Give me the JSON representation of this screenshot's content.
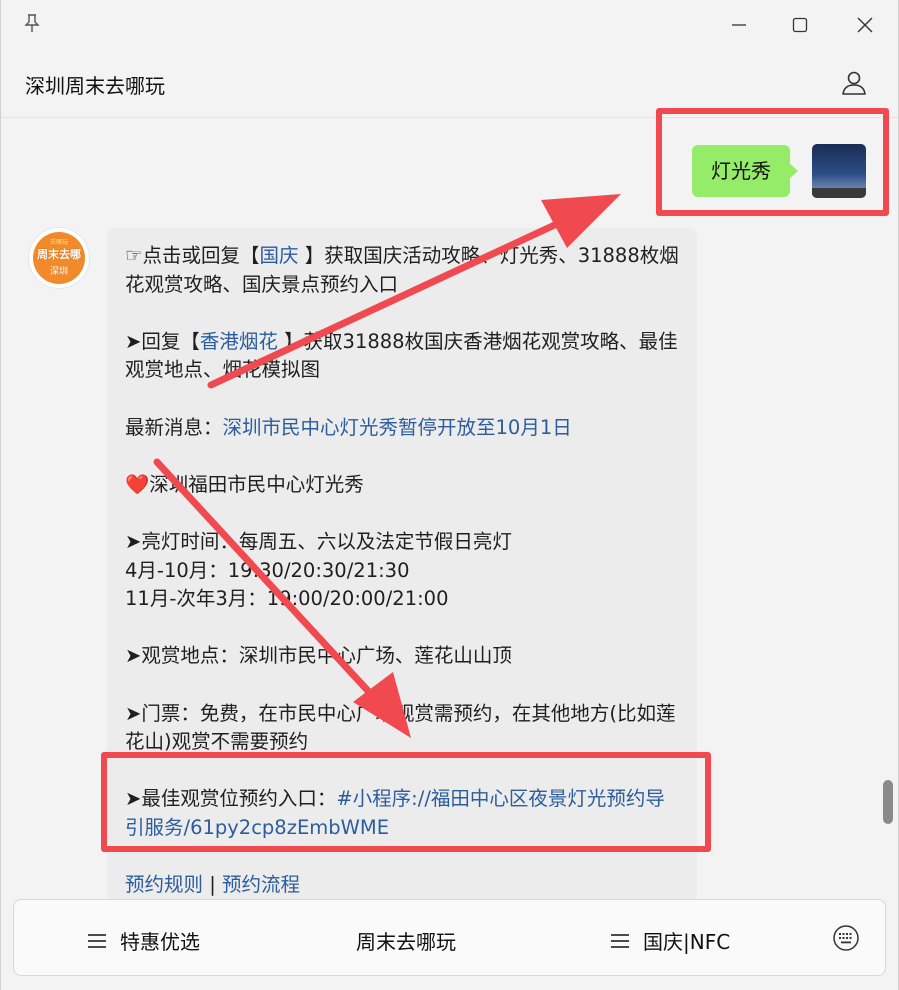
{
  "window": {
    "title": "深圳周末去哪玩"
  },
  "chat": {
    "sent_message": "灯光秀",
    "bot_avatar": {
      "top_text": "去哪玩",
      "brand": "周末去哪",
      "city": "深圳"
    },
    "reply": {
      "line1_pre": "☞点击或回复【",
      "line1_link": "国庆",
      "line1_post": " 】获取国庆活动攻略、灯光秀、31888枚烟花观赏攻略、国庆景点预约入口",
      "line2_pre": "➤回复【",
      "line2_link": "香港烟花",
      "line2_post": " 】获取31888枚国庆香港烟花观赏攻略、最佳观赏地点、烟花模拟图",
      "news_label": "最新消息：",
      "news_link": "深圳市民中心灯光秀暂停开放至10月1日",
      "heart_title": "❤️深圳福田市民中心灯光秀",
      "time_label": "➤亮灯时间：每周五、六以及法定节假日亮灯",
      "time_line1": "4月-10月：19:30/20:30/21:30",
      "time_line2": "11月-次年3月：19:00/20:00/21:00",
      "location": "➤观赏地点：深圳市民中心广场、莲花山山顶",
      "ticket": "➤门票：免费，在市民中心广场观赏需预约，在其他地方(比如莲花山)观赏不需要预约",
      "booking_label": "➤最佳观赏位预约入口：",
      "booking_link": "#小程序://福田中心区夜景灯光预约导引服务/61py2cp8zEmbWME",
      "rules_link": "预约规则",
      "separator": " | ",
      "process_link": "预约流程"
    }
  },
  "menu": {
    "item1": "特惠优选",
    "item2": "周末去哪玩",
    "item3": "国庆|NFC"
  },
  "colors": {
    "sent_bubble": "#95ec69",
    "link": "#2b5d9e",
    "annotation": "#f04a50"
  }
}
